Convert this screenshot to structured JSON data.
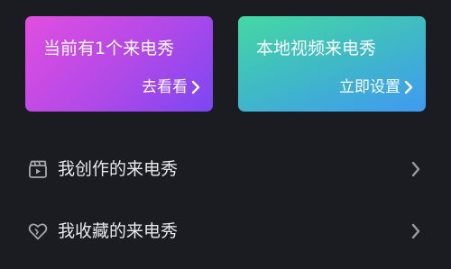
{
  "cards": [
    {
      "title": "当前有1个来电秀",
      "action": "去看看"
    },
    {
      "title": "本地视频来电秀",
      "action": "立即设置"
    }
  ],
  "menu": [
    {
      "label": "我创作的来电秀",
      "icon": "video-clapper-icon"
    },
    {
      "label": "我收藏的来电秀",
      "icon": "heart-icon"
    }
  ],
  "colors": {
    "background": "#1b1c22",
    "card_left_gradient": [
      "#e24ee0",
      "#7b47f2"
    ],
    "card_right_gradient": [
      "#44d8a4",
      "#3f9af2"
    ],
    "text": "#ffffff",
    "icon_muted": "#9a9aa2"
  }
}
